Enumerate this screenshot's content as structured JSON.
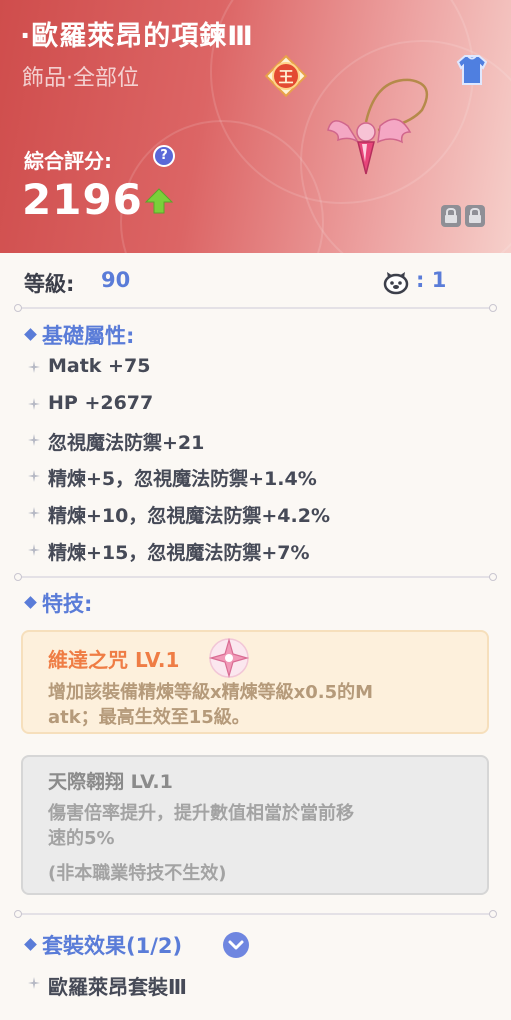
{
  "item": {
    "title": "·歐羅萊昂的項鍊Ⅲ",
    "subtitle": "飾品·全部位",
    "rank_icon": "king-rank-badge-icon",
    "slot_icon": "armor-icon",
    "score_label": "綜合評分:",
    "score_value": "2196",
    "score_trend_icon": "up-arrow-icon",
    "lock_icons": [
      "lock-icon",
      "lock-icon"
    ]
  },
  "level": {
    "label": "等級:",
    "value": "90",
    "pet_icon": "pet-face-icon",
    "pet_value": ": 1"
  },
  "base_attributes": {
    "title": "基礎屬性:",
    "items": [
      "Matk +75",
      "HP +2677",
      "忽視魔法防禦+21",
      "精煉+5，忽視魔法防禦+1.4%",
      "精煉+10，忽視魔法防禦+4.2%",
      "精煉+15，忽視魔法防禦+7%"
    ]
  },
  "skills": {
    "title": "特技:",
    "active": {
      "name": "維達之咒 LV.1",
      "icon": "pink-star-icon",
      "desc_line1": "增加該裝備精煉等級x精煉等級x0.5的M",
      "desc_line2": "atk；最高生效至15級。"
    },
    "inactive": {
      "name": "天際翱翔 LV.1",
      "desc_line1": "傷害倍率提升，提升數值相當於當前移",
      "desc_line2": "速的5%",
      "note": "(非本職業特技不生效)"
    }
  },
  "set_effect": {
    "title": "套裝效果(1/2)",
    "toggle_icon": "chevron-down-icon",
    "item": "歐羅萊昂套裝Ⅲ"
  },
  "colors": {
    "header_red": "#cf4d4c",
    "accent_blue": "#5a7cd8",
    "skill_orange": "#ef7d45",
    "score_up_green": "#7ad03a"
  }
}
